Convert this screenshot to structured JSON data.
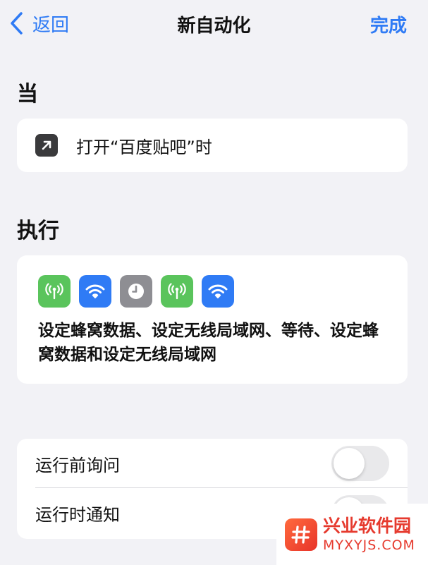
{
  "nav": {
    "back_label": "返回",
    "title": "新自动化",
    "done_label": "完成"
  },
  "trigger_section": {
    "title": "当",
    "trigger_text": "打开“百度贴吧”时",
    "icon": "arrow-up-right-icon"
  },
  "action_section": {
    "title": "执行",
    "icons": [
      {
        "name": "cellular-icon",
        "color": "#5ac45c"
      },
      {
        "name": "wifi-icon",
        "color": "#2f7bf5"
      },
      {
        "name": "clock-icon",
        "color": "#8e8e93"
      },
      {
        "name": "cellular-icon",
        "color": "#5ac45c"
      },
      {
        "name": "wifi-icon",
        "color": "#2f7bf5"
      }
    ],
    "summary": "设定蜂窝数据、设定无线局域网、等待、设定蜂窝数据和设定无线局域网"
  },
  "options": {
    "ask_before_running": {
      "label": "运行前询问",
      "enabled": false
    },
    "notify_when_run": {
      "label": "运行时通知",
      "enabled": false
    }
  },
  "watermark": {
    "name": "兴业软件园",
    "url": "MYXYJS.COM"
  },
  "colors": {
    "accent": "#2f7bf5",
    "background": "#f2f2f6",
    "cellular": "#5ac45c",
    "wifi": "#2f7bf5",
    "clock": "#8e8e93",
    "watermark": "#e63a2e"
  }
}
